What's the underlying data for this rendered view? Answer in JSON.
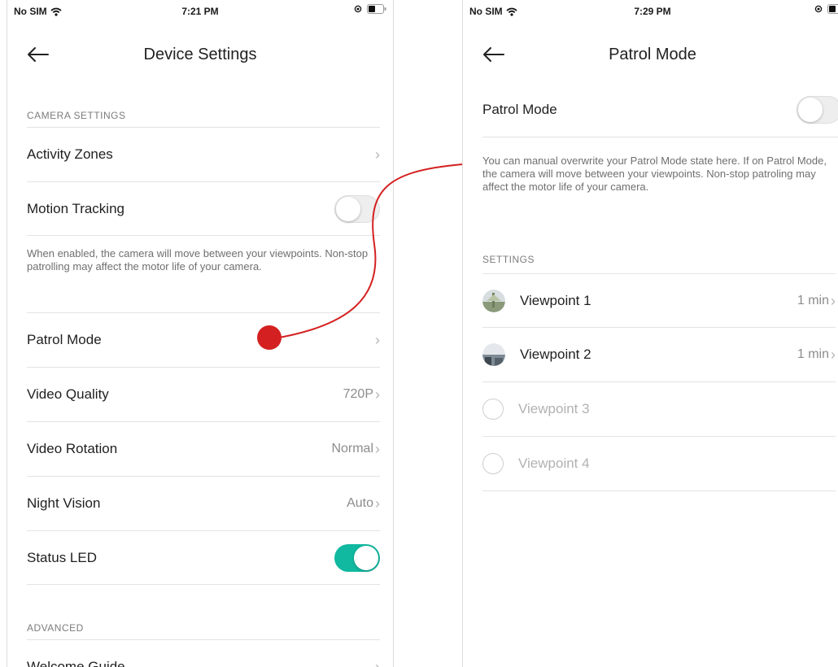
{
  "left": {
    "status": {
      "carrier": "No SIM",
      "time": "7:21 PM"
    },
    "title": "Device Settings",
    "camera_settings_header": "CAMERA SETTINGS",
    "activity_zones": "Activity Zones",
    "motion_tracking": "Motion Tracking",
    "motion_tracking_on": false,
    "motion_desc": "When enabled, the camera will move between your viewpoints. Non-stop patrolling may affect the motor life of your camera.",
    "patrol_mode": "Patrol Mode",
    "video_quality": {
      "label": "Video Quality",
      "value": "720P"
    },
    "video_rotation": {
      "label": "Video Rotation",
      "value": "Normal"
    },
    "night_vision": {
      "label": "Night Vision",
      "value": "Auto"
    },
    "status_led": "Status LED",
    "status_led_on": true,
    "advanced_header": "ADVANCED",
    "welcome_guide": "Welcome Guide"
  },
  "right": {
    "status": {
      "carrier": "No SIM",
      "time": "7:29 PM"
    },
    "title": "Patrol Mode",
    "patrol_mode_label": "Patrol Mode",
    "patrol_mode_on": false,
    "desc": "You can manual overwrite your Patrol Mode state here. If on Patrol Mode, the camera will move between your viewpoints. Non-stop patroling may affect the motor life of your camera.",
    "settings_header": "SETTINGS",
    "viewpoints": [
      {
        "label": "Viewpoint 1",
        "value": "1 min",
        "enabled": true
      },
      {
        "label": "Viewpoint 2",
        "value": "1 min",
        "enabled": true
      },
      {
        "label": "Viewpoint 3",
        "value": "",
        "enabled": false
      },
      {
        "label": "Viewpoint 4",
        "value": "",
        "enabled": false
      }
    ]
  },
  "colors": {
    "accent": "#10b9a0",
    "annotation": "#d42020"
  },
  "icons": [
    "wifi-icon",
    "battery-icon",
    "back-arrow-icon",
    "chevron-right-icon"
  ]
}
